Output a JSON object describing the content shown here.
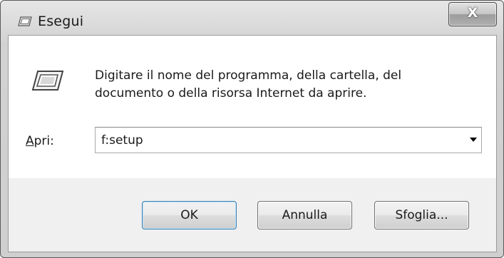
{
  "window": {
    "title": "Esegui",
    "close_glyph": "X"
  },
  "dialog": {
    "description": "Digitare il nome del programma, della cartella, del documento o della risorsa Internet da aprire.",
    "open_label_accel": "A",
    "open_label_rest": "pri:",
    "command_value": "f:setup"
  },
  "buttons": {
    "ok": "OK",
    "cancel": "Annulla",
    "browse": "Sfoglia..."
  },
  "icons": {
    "title_icon": "run-icon",
    "main_icon": "run-icon",
    "combo_arrow": "chevron-down-icon",
    "close": "close-icon"
  },
  "colors": {
    "content_bg": "#ffffff",
    "footer_bg": "#f0f0f0",
    "frame": "#d2d2d2",
    "default_button_border": "#3c7fb1"
  }
}
